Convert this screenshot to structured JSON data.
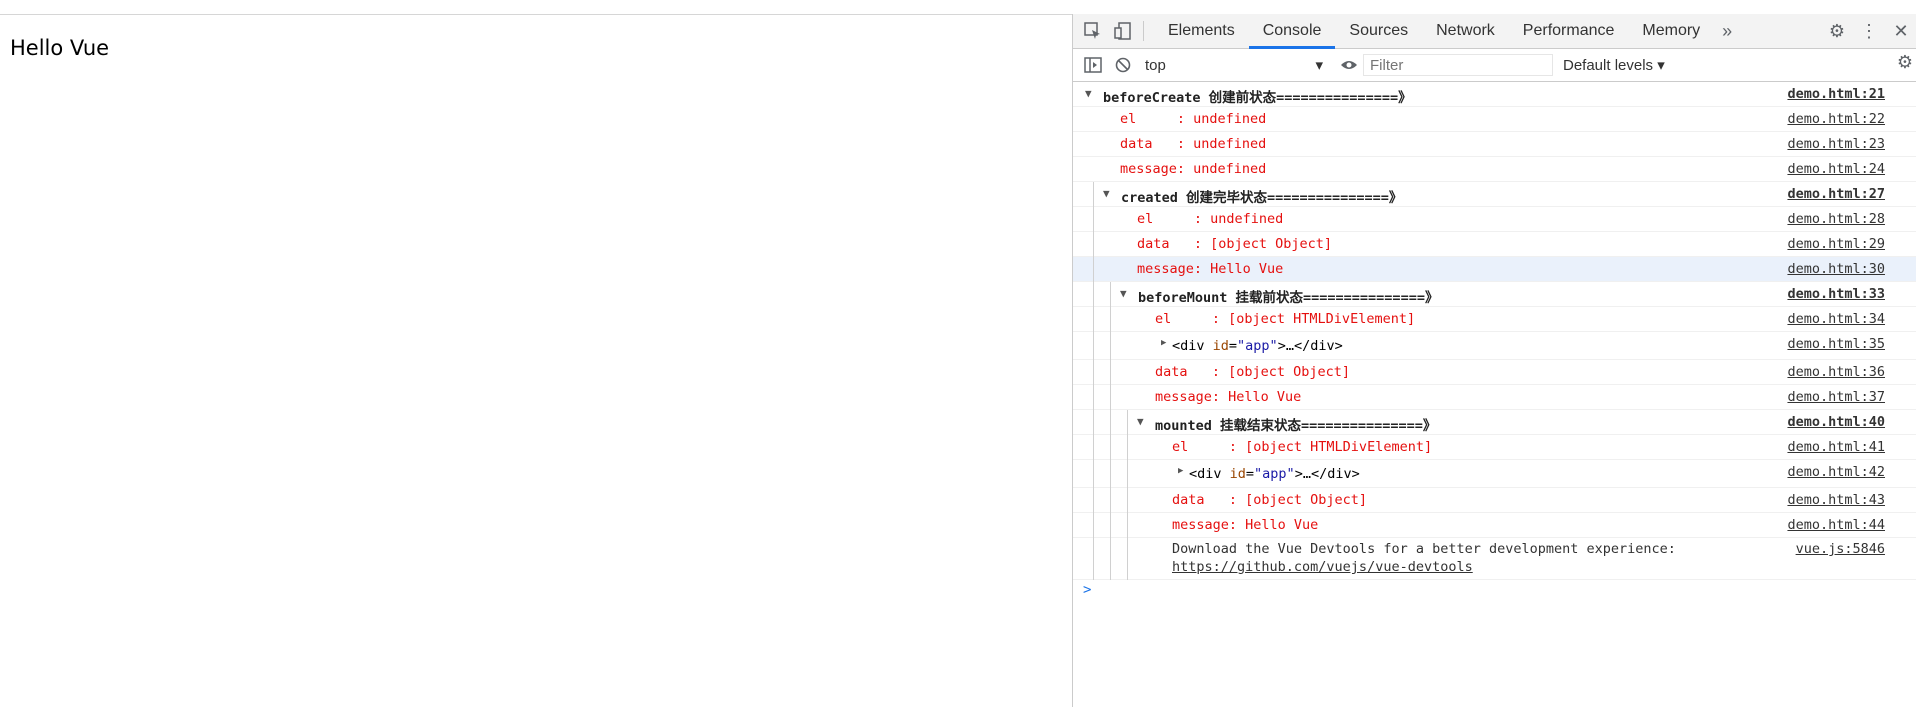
{
  "page": {
    "app_text": "Hello Vue"
  },
  "devtools": {
    "tabs": [
      "Elements",
      "Console",
      "Sources",
      "Network",
      "Performance",
      "Memory"
    ],
    "active_tab": "Console",
    "more_label": "»",
    "console_toolbar": {
      "context": "top",
      "filter_placeholder": "Filter",
      "levels": "Default levels"
    }
  },
  "console": {
    "lines": [
      {
        "type": "group",
        "text": "beforeCreate 创建前状态===============》",
        "src": "demo.html:21"
      },
      {
        "type": "red",
        "text": "el     : undefined",
        "src": "demo.html:22"
      },
      {
        "type": "red",
        "text": "data   : undefined",
        "src": "demo.html:23"
      },
      {
        "type": "red",
        "text": "message: undefined",
        "src": "demo.html:24"
      },
      {
        "type": "group",
        "text": "created 创建完毕状态===============》",
        "src": "demo.html:27"
      },
      {
        "type": "red",
        "text": "el     : undefined",
        "src": "demo.html:28"
      },
      {
        "type": "red",
        "text": "data   : [object Object]",
        "src": "demo.html:29"
      },
      {
        "type": "red",
        "text": "message: Hello Vue",
        "src": "demo.html:30"
      },
      {
        "type": "group",
        "text": "beforeMount 挂载前状态===============》",
        "src": "demo.html:33"
      },
      {
        "type": "red",
        "text": "el     : [object HTMLDivElement]",
        "src": "demo.html:34"
      },
      {
        "type": "element",
        "tag_open": "<div ",
        "attr_name": "id",
        "attr_value": "\"app\"",
        "tag_close": ">…</div>",
        "src": "demo.html:35"
      },
      {
        "type": "red",
        "text": "data   : [object Object]",
        "src": "demo.html:36"
      },
      {
        "type": "red",
        "text": "message: Hello Vue",
        "src": "demo.html:37"
      },
      {
        "type": "group",
        "text": "mounted 挂载结束状态===============》",
        "src": "demo.html:40"
      },
      {
        "type": "red",
        "text": "el     : [object HTMLDivElement]",
        "src": "demo.html:41"
      },
      {
        "type": "element",
        "tag_open": "<div ",
        "attr_name": "id",
        "attr_value": "\"app\"",
        "tag_close": ">…</div>",
        "src": "demo.html:42"
      },
      {
        "type": "red",
        "text": "data   : [object Object]",
        "src": "demo.html:43"
      },
      {
        "type": "red",
        "text": "message: Hello Vue",
        "src": "demo.html:44"
      },
      {
        "type": "info",
        "text": "Download the Vue Devtools for a better development experience:",
        "link": "https://github.com/vuejs/vue-devtools",
        "src": "vue.js:5846"
      }
    ],
    "prompt_symbol": ">"
  },
  "colors": {
    "accent": "#1a73e8",
    "error_text": "#e5100f",
    "highlight_row": "#eaf1fb"
  }
}
